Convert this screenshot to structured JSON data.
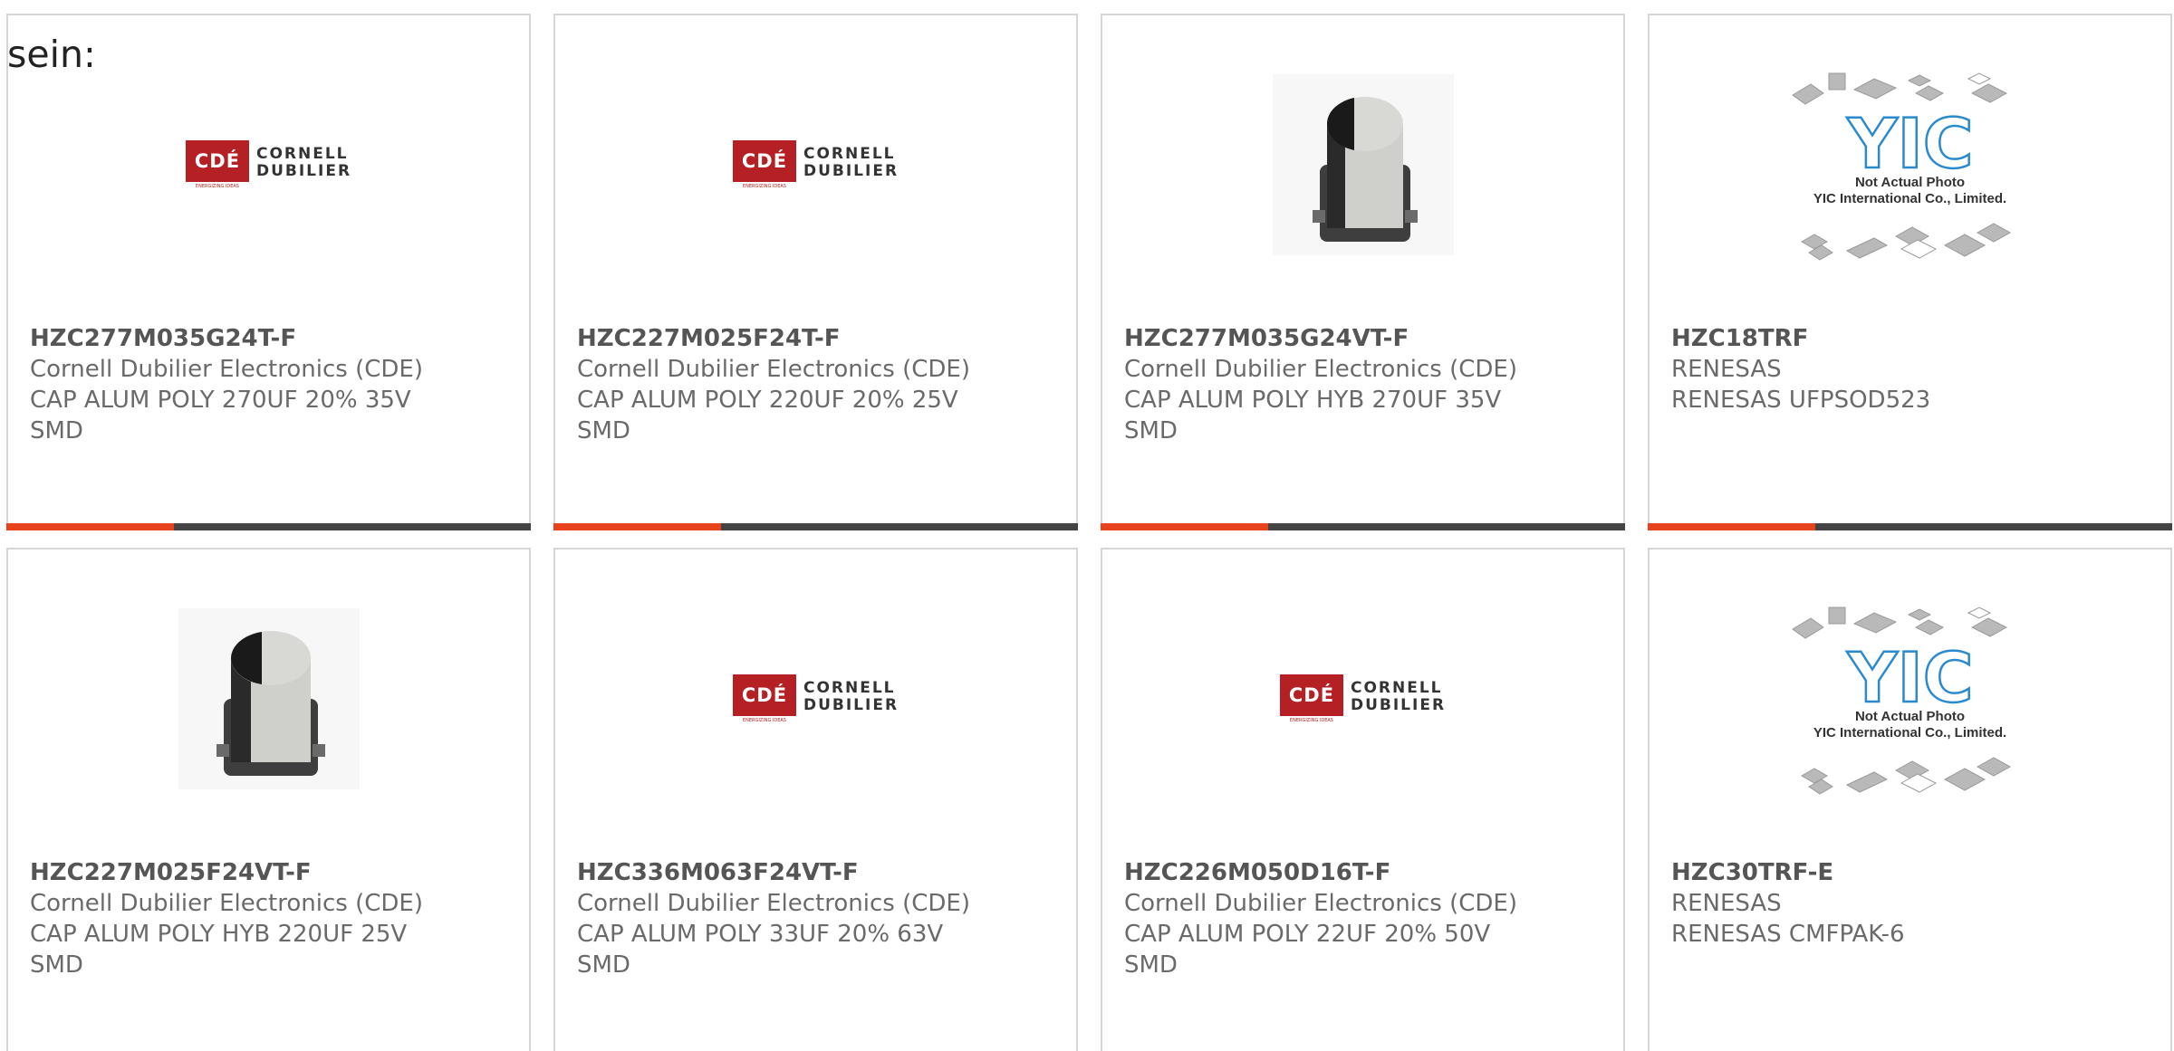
{
  "heading": "sein:",
  "colors": {
    "accent": "#e8431c",
    "bar_dark": "#444444",
    "cde_red": "#b52024",
    "yic_blue": "#2a8ad0"
  },
  "cde_logo": {
    "mark": "CDÉ",
    "line1": "CORNELL",
    "line2": "DUBILIER",
    "tagline": "ENERGIZING IDEAS"
  },
  "yic_placeholder": {
    "brand": "YIC",
    "line1": "Not Actual Photo",
    "line2": "YIC International Co., Limited."
  },
  "products": [
    {
      "image": "cde-logo",
      "part_number": "HZC277M035G24T-F",
      "manufacturer": "Cornell Dubilier Electronics (CDE)",
      "description": "CAP ALUM POLY 270UF 20% 35V",
      "package": "SMD"
    },
    {
      "image": "cde-logo",
      "part_number": "HZC227M025F24T-F",
      "manufacturer": "Cornell Dubilier Electronics (CDE)",
      "description": "CAP ALUM POLY 220UF 20% 25V",
      "package": "SMD"
    },
    {
      "image": "capacitor-photo",
      "part_number": "HZC277M035G24VT-F",
      "manufacturer": "Cornell Dubilier Electronics (CDE)",
      "description": "CAP ALUM POLY HYB 270UF 35V",
      "package": "SMD"
    },
    {
      "image": "yic-placeholder",
      "part_number": "HZC18TRF",
      "manufacturer": "RENESAS",
      "description": "RENESAS UFPSOD523",
      "package": ""
    },
    {
      "image": "capacitor-photo",
      "part_number": "HZC227M025F24VT-F",
      "manufacturer": "Cornell Dubilier Electronics (CDE)",
      "description": "CAP ALUM POLY HYB 220UF 25V",
      "package": "SMD"
    },
    {
      "image": "cde-logo",
      "part_number": "HZC336M063F24VT-F",
      "manufacturer": "Cornell Dubilier Electronics (CDE)",
      "description": "CAP ALUM POLY 33UF 20% 63V",
      "package": "SMD"
    },
    {
      "image": "cde-logo",
      "part_number": "HZC226M050D16T-F",
      "manufacturer": "Cornell Dubilier Electronics (CDE)",
      "description": "CAP ALUM POLY 22UF 20% 50V",
      "package": "SMD"
    },
    {
      "image": "yic-placeholder",
      "part_number": "HZC30TRF-E",
      "manufacturer": "RENESAS",
      "description": "RENESAS CMFPAK-6",
      "package": ""
    }
  ]
}
